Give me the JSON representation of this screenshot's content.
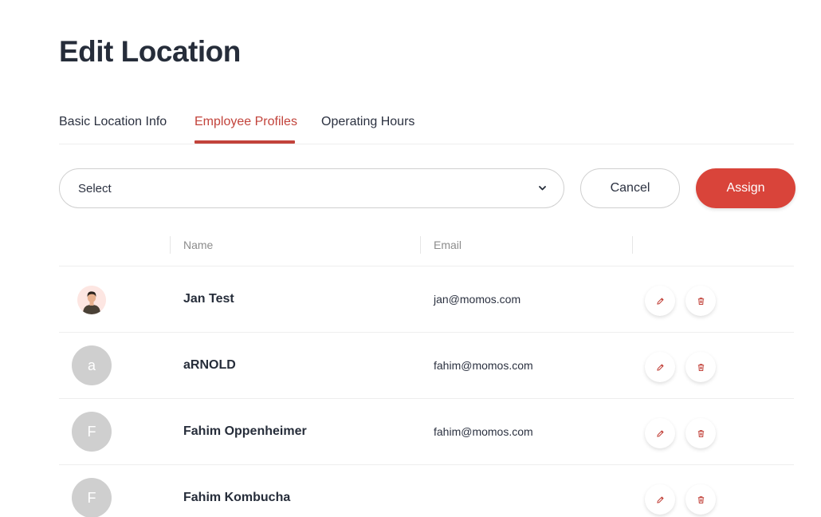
{
  "page": {
    "title": "Edit Location"
  },
  "tabs": [
    {
      "label": "Basic Location Info",
      "active": false
    },
    {
      "label": "Employee Profiles",
      "active": true
    },
    {
      "label": "Operating Hours",
      "active": false
    }
  ],
  "assign_bar": {
    "select_value": "Select",
    "cancel_label": "Cancel",
    "assign_label": "Assign"
  },
  "table": {
    "columns": {
      "name": "Name",
      "email": "Email"
    },
    "rows": [
      {
        "avatar": "photo",
        "initial": "",
        "name": "Jan Test",
        "email": "jan@momos.com"
      },
      {
        "avatar": "initial",
        "initial": "a",
        "name": "aRNOLD",
        "email": "fahim@momos.com"
      },
      {
        "avatar": "initial",
        "initial": "F",
        "name": "Fahim Oppenheimer",
        "email": "fahim@momos.com"
      },
      {
        "avatar": "initial",
        "initial": "F",
        "name": "Fahim Kombucha",
        "email": ""
      }
    ]
  },
  "colors": {
    "accent": "#c2433b",
    "assign_button": "#d9443a",
    "avatar_placeholder": "#cfcfcf"
  },
  "icons": {
    "edit": "pencil-icon",
    "delete": "trash-icon",
    "dropdown": "chevron-down-icon"
  }
}
